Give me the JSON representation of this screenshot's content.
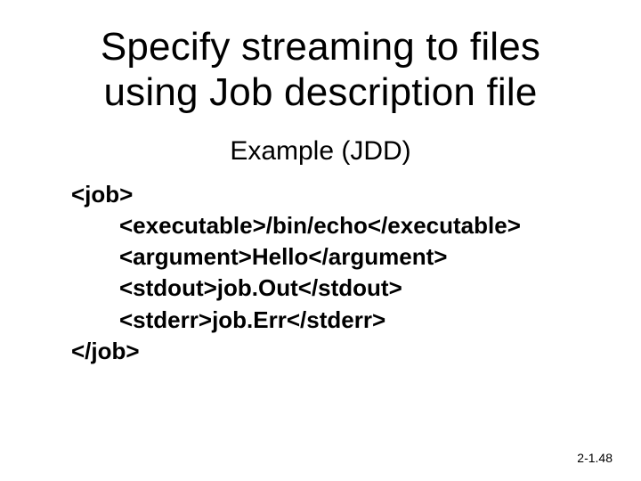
{
  "title_line1": "Specify streaming to files",
  "title_line2": "using Job description file",
  "subtitle": "Example (JDD)",
  "code": {
    "open": "<job>",
    "executable": "<executable>/bin/echo</executable>",
    "argument": "<argument>Hello</argument>",
    "stdout": "<stdout>job.Out</stdout>",
    "stderr": "<stderr>job.Err</stderr>",
    "close": "</job>"
  },
  "footer": "2-1.48"
}
